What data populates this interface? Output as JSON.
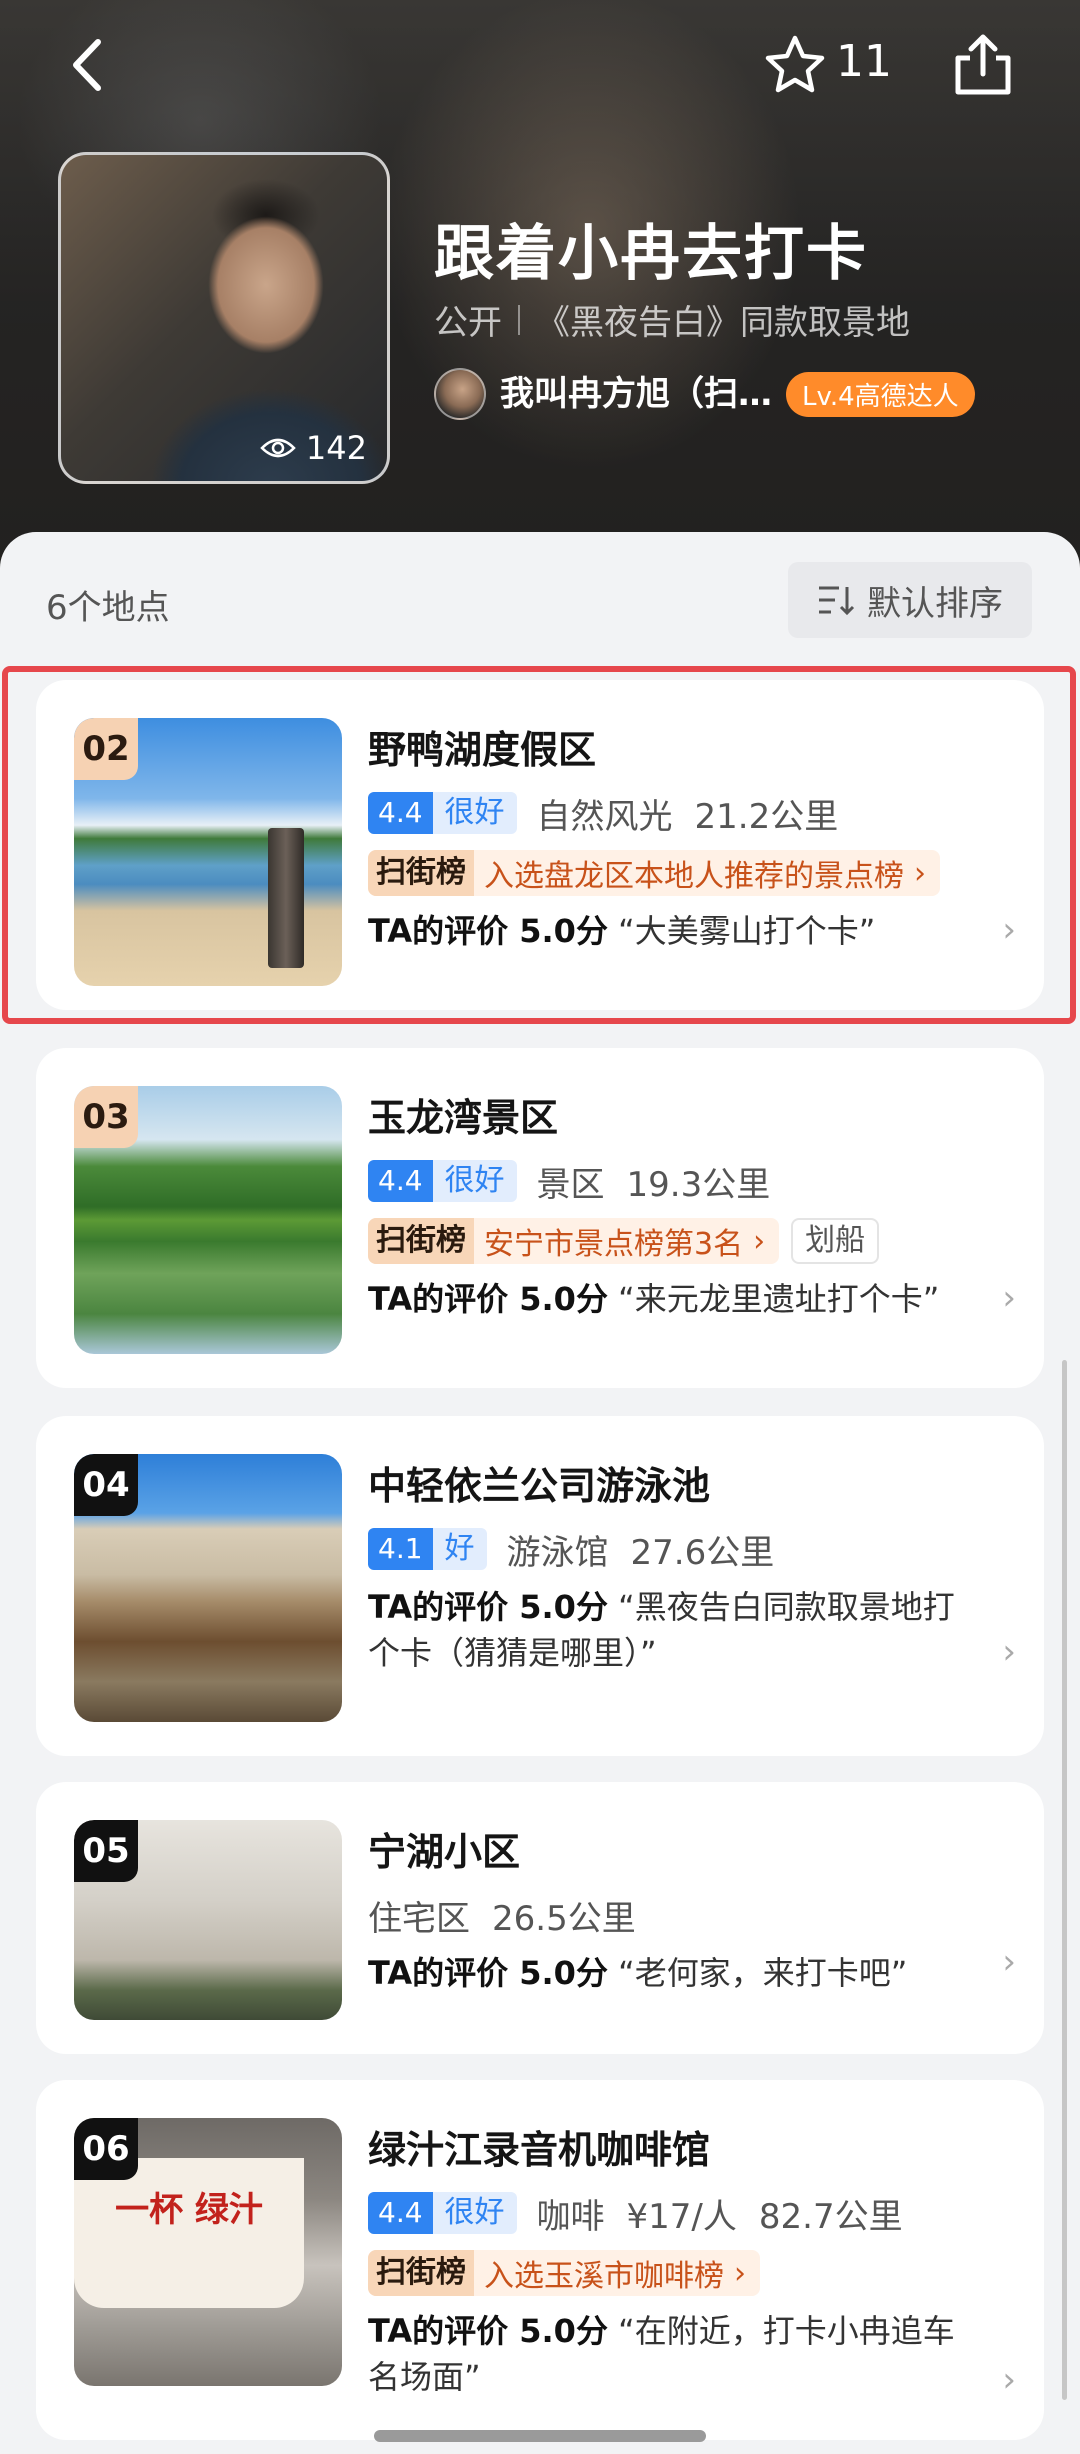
{
  "header": {
    "fav_count": "11",
    "views": "142",
    "title": "跟着小冉去打卡",
    "visibility": "公开",
    "description": "《黑夜告白》同款取景地",
    "author_name": "我叫冉方旭（扫…",
    "author_badge": "Lv.4高德达人"
  },
  "list": {
    "count_label": "6个地点",
    "sort_label": "默认排序"
  },
  "places": [
    {
      "rank": "02",
      "name": "野鸭湖度假区",
      "score": "4.4",
      "score_word": "很好",
      "category": "自然风光",
      "distance": "21.2公里",
      "rank_logo": "扫街榜",
      "rank_text": "入选盘龙区本地人推荐的景点榜",
      "review_label": "TA的评价 5.0分",
      "review_text": "“大美雾山打个卡”"
    },
    {
      "rank": "03",
      "name": "玉龙湾景区",
      "score": "4.4",
      "score_word": "很好",
      "category": "景区",
      "distance": "19.3公里",
      "rank_logo": "扫街榜",
      "rank_text": "安宁市景点榜第3名",
      "tag": "划船",
      "review_label": "TA的评价 5.0分",
      "review_text": "“来元龙里遗址打个卡”"
    },
    {
      "rank": "04",
      "name": "中轻依兰公司游泳池",
      "score": "4.1",
      "score_word": "好",
      "category": "游泳馆",
      "distance": "27.6公里",
      "review_label": "TA的评价 5.0分",
      "review_text": "“黑夜告白同款取景地打个卡（猜猜是哪里）”"
    },
    {
      "rank": "05",
      "name": "宁湖小区",
      "category": "住宅区",
      "distance": "26.5公里",
      "review_label": "TA的评价 5.0分",
      "review_text": "“老何家，来打卡吧”"
    },
    {
      "rank": "06",
      "name": "绿汁江录音机咖啡馆",
      "score": "4.4",
      "score_word": "很好",
      "category": "咖啡",
      "price": "¥17/人",
      "distance": "82.7公里",
      "rank_logo": "扫街榜",
      "rank_text": "入选玉溪市咖啡榜",
      "review_label": "TA的评价 5.0分",
      "review_text": "“在附近，打卡小冉追车名场面”",
      "sign_text": "一杯 绿汁"
    }
  ],
  "colors": {
    "accent_blue": "#2f84f2",
    "badge_orange": "#ff8b2a",
    "highlight_red": "#e6474c"
  },
  "icons": [
    "back-arrow-icon",
    "star-icon",
    "share-icon",
    "eye-icon",
    "sort-icon",
    "chevron-right-icon"
  ]
}
